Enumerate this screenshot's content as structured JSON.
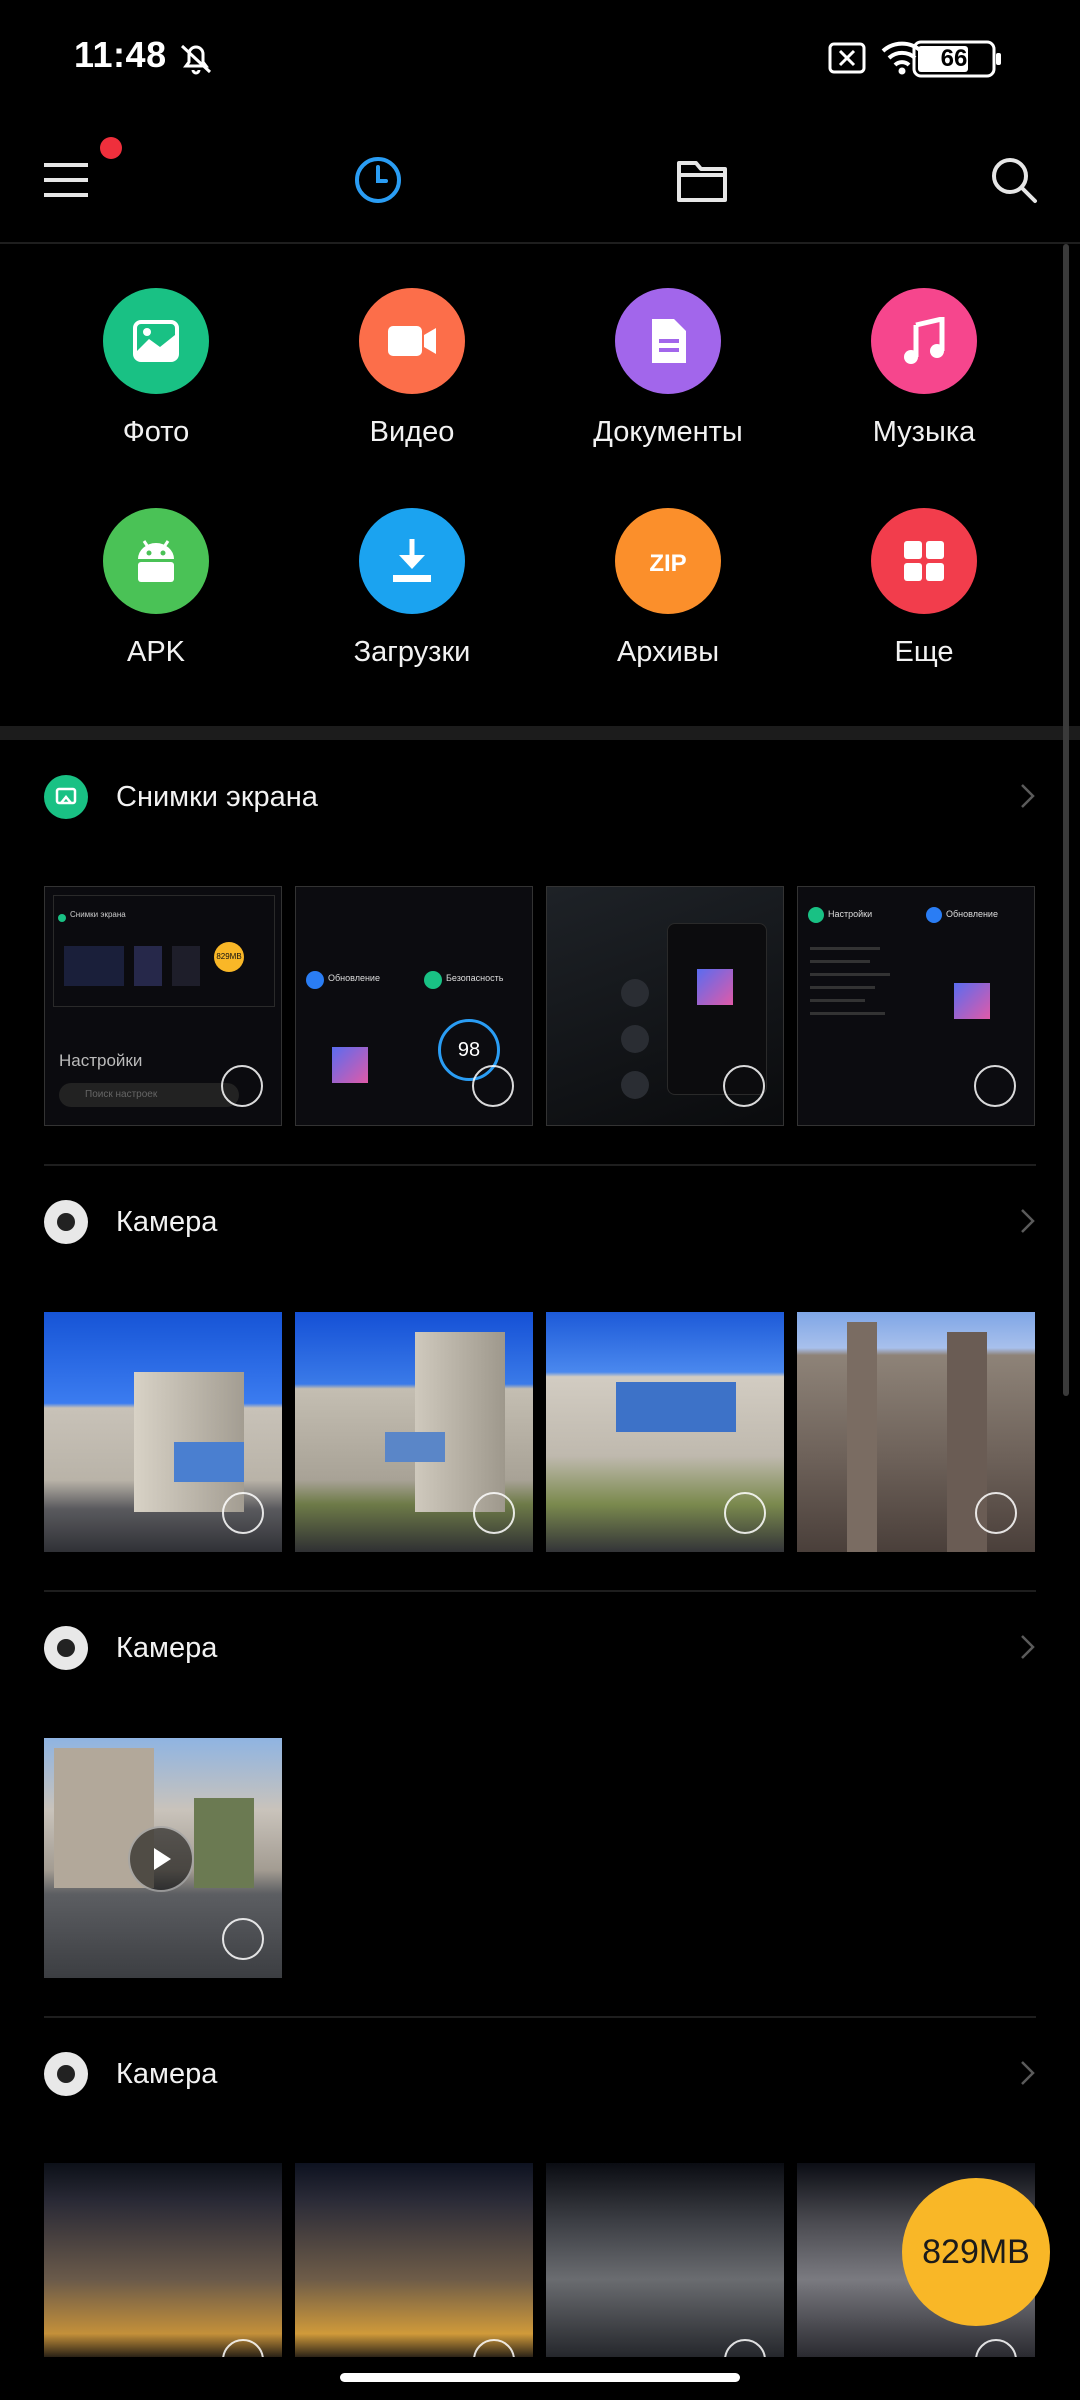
{
  "status": {
    "time": "11:48",
    "battery": "66"
  },
  "toolbar": {
    "menu_icon": "hamburger-icon",
    "recent_icon": "clock-icon",
    "folder_icon": "folder-icon",
    "search_icon": "search-icon",
    "accent": "#2a9df4",
    "notification_color": "#ef2f3c"
  },
  "categories": [
    {
      "label": "Фото",
      "icon": "image-icon",
      "color": "#19c184"
    },
    {
      "label": "Видео",
      "icon": "video-icon",
      "color": "#fc6e4a"
    },
    {
      "label": "Документы",
      "icon": "document-icon",
      "color": "#a266eb"
    },
    {
      "label": "Музыка",
      "icon": "music-icon",
      "color": "#f6468d"
    },
    {
      "label": "APK",
      "icon": "android-icon",
      "color": "#4ac256"
    },
    {
      "label": "Загрузки",
      "icon": "download-icon",
      "color": "#1ba3f0"
    },
    {
      "label": "Архивы",
      "icon": "zip-icon",
      "color": "#fb8f2b"
    },
    {
      "label": "Еще",
      "icon": "grid-icon",
      "color": "#f23d4c"
    }
  ],
  "sections": [
    {
      "title": "Снимки экрана",
      "icon": "screenshot-icon",
      "items": [
        {
          "kind": "screenshot",
          "text": "Настройки",
          "subtext": "Поиск настроек",
          "header": "Снимки экрана",
          "badge": "829MB"
        },
        {
          "kind": "screenshot",
          "text": "Обновление",
          "text2": "Безопасность",
          "score": "98"
        },
        {
          "kind": "screenshot"
        },
        {
          "kind": "screenshot",
          "text": "Настройки",
          "text2": "Обновление"
        }
      ]
    },
    {
      "title": "Камера",
      "icon": "camera-icon",
      "items": [
        {
          "kind": "photo"
        },
        {
          "kind": "photo"
        },
        {
          "kind": "photo"
        },
        {
          "kind": "photo"
        }
      ]
    },
    {
      "title": "Камера",
      "icon": "camera-icon",
      "items": [
        {
          "kind": "video"
        }
      ]
    },
    {
      "title": "Камера",
      "icon": "camera-icon",
      "items": [
        {
          "kind": "night"
        },
        {
          "kind": "night"
        },
        {
          "kind": "night"
        },
        {
          "kind": "night"
        }
      ]
    }
  ],
  "storage_badge": "829MB"
}
